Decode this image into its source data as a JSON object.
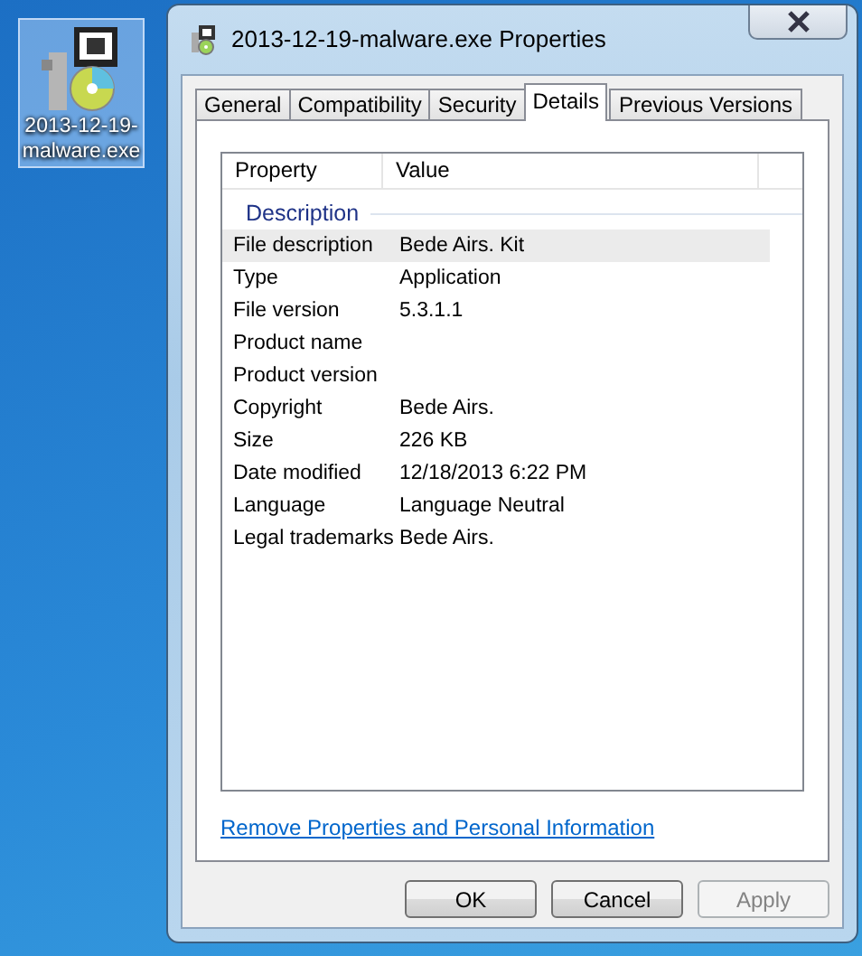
{
  "desktop_icon": {
    "label": "2013-12-19-malware.exe",
    "selected": true
  },
  "window": {
    "title": "2013-12-19-malware.exe Properties"
  },
  "tabs": [
    {
      "label": "General",
      "selected": false
    },
    {
      "label": "Compatibility",
      "selected": false
    },
    {
      "label": "Security",
      "selected": false
    },
    {
      "label": "Details",
      "selected": true
    },
    {
      "label": "Previous Versions",
      "selected": false
    }
  ],
  "details": {
    "columns": [
      "Property",
      "Value"
    ],
    "group": "Description",
    "rows": [
      {
        "property": "File description",
        "value": "Bede Airs. Kit",
        "selected": true
      },
      {
        "property": "Type",
        "value": "Application",
        "selected": false
      },
      {
        "property": "File version",
        "value": "5.3.1.1",
        "selected": false
      },
      {
        "property": "Product name",
        "value": "",
        "selected": false
      },
      {
        "property": "Product version",
        "value": "",
        "selected": false
      },
      {
        "property": "Copyright",
        "value": "Bede Airs.",
        "selected": false
      },
      {
        "property": "Size",
        "value": "226 KB",
        "selected": false
      },
      {
        "property": "Date modified",
        "value": "12/18/2013 6:22 PM",
        "selected": false
      },
      {
        "property": "Language",
        "value": "Language Neutral",
        "selected": false
      },
      {
        "property": "Legal trademarks",
        "value": "Bede Airs.",
        "selected": false
      }
    ]
  },
  "link": "Remove Properties and Personal Information",
  "buttons": [
    {
      "label": "OK",
      "disabled": false
    },
    {
      "label": "Cancel",
      "disabled": false
    },
    {
      "label": "Apply",
      "disabled": true
    }
  ]
}
